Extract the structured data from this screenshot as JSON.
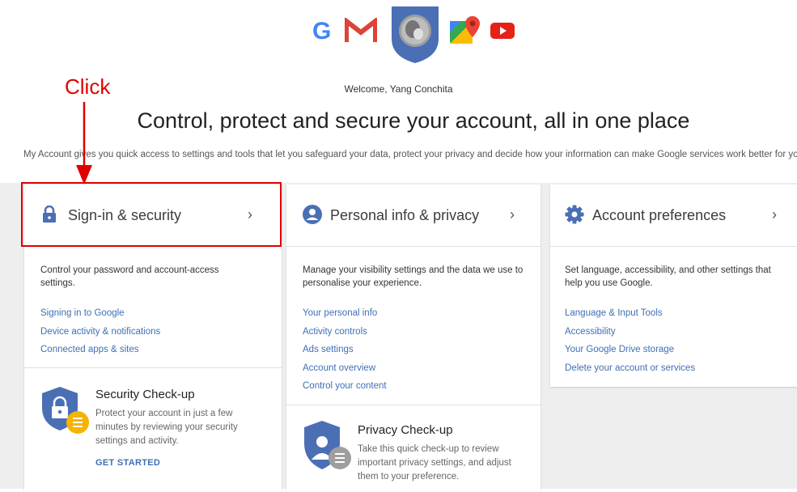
{
  "header": {
    "welcome": "Welcome, Yang Conchita",
    "headline": "Control, protect and secure your account, all in one place",
    "intro": "My Account gives you quick access to settings and tools that let you safeguard your data, protect your privacy and decide how your information can make Google services work better for you"
  },
  "apps": {
    "google_letter": "G",
    "icons": [
      "google-icon",
      "gmail-icon",
      "avatar",
      "maps-icon",
      "youtube-icon"
    ]
  },
  "annotation": {
    "label": "Click",
    "color": "#e00000"
  },
  "cards": {
    "security": {
      "title": "Sign-in & security",
      "description": "Control your password and account-access settings.",
      "links": [
        "Signing in to Google",
        "Device activity & notifications",
        "Connected apps & sites"
      ],
      "checkup": {
        "title": "Security Check-up",
        "description": "Protect your account in just a few minutes by reviewing your security settings and activity.",
        "cta": "GET STARTED"
      }
    },
    "privacy": {
      "title": "Personal info & privacy",
      "description": "Manage your visibility settings and the data we use to personalise your experience.",
      "links": [
        "Your personal info",
        "Activity controls",
        "Ads settings",
        "Account overview",
        "Control your content"
      ],
      "checkup": {
        "title": "Privacy Check-up",
        "description": "Take this quick check-up to review important privacy settings, and adjust them to your preference."
      }
    },
    "preferences": {
      "title": "Account preferences",
      "description": "Set language, accessibility, and other settings that help you use Google.",
      "links": [
        "Language & Input Tools",
        "Accessibility",
        "Your Google Drive storage",
        "Delete your account or services"
      ]
    }
  },
  "colors": {
    "accent": "#4a6fb5",
    "link": "#3f6fb5",
    "highlight": "#e00000",
    "badge": "#f4b400"
  }
}
